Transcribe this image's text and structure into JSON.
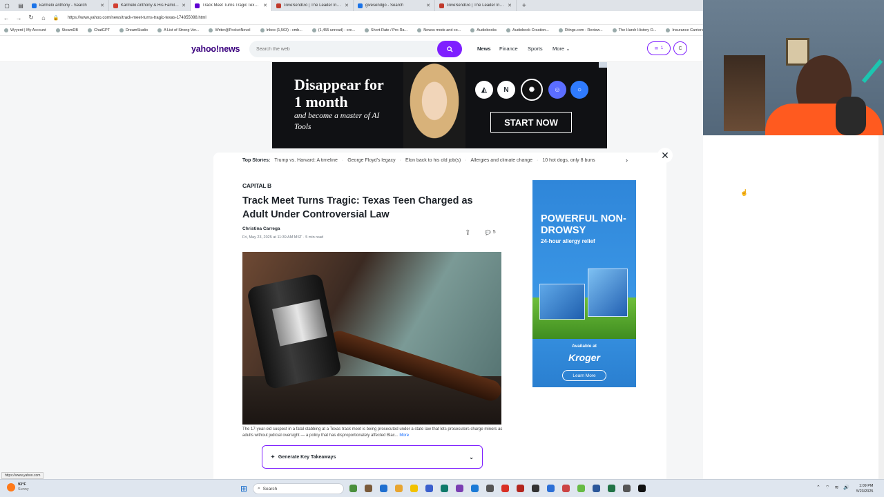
{
  "browser": {
    "tabs": [
      {
        "title": "karmelo anthony - Search",
        "color": "#1a73e8"
      },
      {
        "title": "Karmelo Anthony & His Family Ra...",
        "color": "#d23f31"
      },
      {
        "title": "Track Meet Turns Tragic Texas Te...",
        "color": "#6001d2",
        "active": true
      },
      {
        "title": "GiveSendGo | The Leader In Onlin...",
        "color": "#c0392b"
      },
      {
        "title": "givesendgo - Search",
        "color": "#1a73e8"
      },
      {
        "title": "GiveSendGo | The Leader In Onlin...",
        "color": "#c0392b"
      }
    ],
    "new_tab": "+",
    "url": "https://www.yahoo.com/news/track-meet-turns-tragic-texas-174855098.html",
    "bookmarks": [
      "Wyyerd | My Account",
      "SteamDB",
      "ChatGPT",
      "DreamStudio",
      "A List of Strong Ver...",
      "Writer@PocketNovel",
      "Inbox (1,563) - cmb...",
      "(1,455 unread) - cre...",
      "Short-Rate / Pro-Ra...",
      "Newss mods and co...",
      "Audiobooks",
      "Audiobook Creation...",
      "Rtings.com - Review...",
      "The Harsh History O...",
      "Insurance Carriers"
    ],
    "status_url": "https://www.yahoo.com"
  },
  "header": {
    "logo": "yahoo!news",
    "search_placeholder": "Search the web",
    "nav": [
      "News",
      "Finance",
      "Sports",
      "More"
    ],
    "mail_count": "1",
    "avatar_letter": "C"
  },
  "top_ad": {
    "headline": "Disappear for 1 month",
    "subline": "and become a master of AI Tools",
    "cta": "START NOW"
  },
  "article": {
    "top_stories_label": "Top Stories:",
    "top_stories": [
      "Trump vs. Harvard: A timeline",
      "George Floyd's legacy",
      "Elon back to his old job(s)",
      "Allergies and climate change",
      "10 hot dogs, only 8 buns"
    ],
    "publisher": "CAPITAL B",
    "headline": "Track Meet Turns Tragic: Texas Teen Charged as Adult Under Controversial Law",
    "author": "Christina Carrega",
    "date": "Fri, May 23, 2025 at 11:39 AM MST",
    "read_time": "5 min read",
    "comment_count": "5",
    "caption": "The 17-year-old suspect in a fatal stabbing at a Texas track meet is being prosecuted under a state law that lets prosecutors charge minors as adults without judicial oversight — a policy that has disproportionately affected Blac...",
    "caption_more": "More",
    "takeaways_label": "Generate Key Takeaways"
  },
  "side_ad": {
    "headline": "POWERFUL NON-DROWSY",
    "sub": "24-hour allergy relief",
    "available": "Available at",
    "store": "Kroger",
    "cta": "Learn More"
  },
  "taskbar": {
    "temp": "93°F",
    "condition": "Sunny",
    "search_label": "Search",
    "time": "1:09 PM",
    "date": "5/23/2025"
  }
}
